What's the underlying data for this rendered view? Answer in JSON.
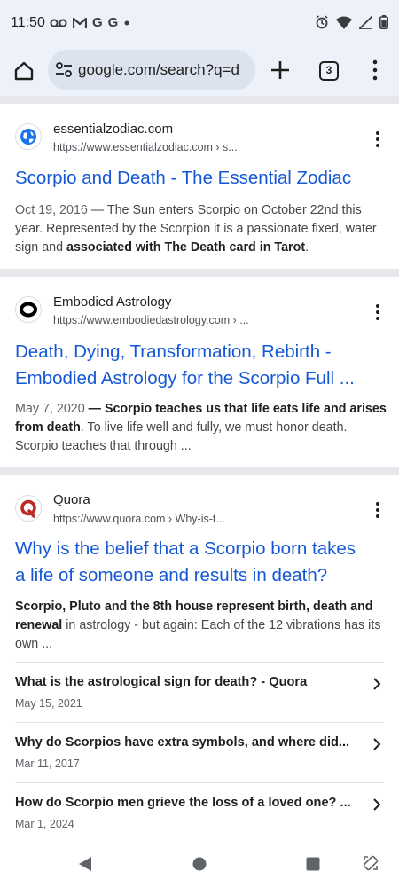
{
  "status_bar": {
    "time": "11:50",
    "left_icons": [
      "voicemail-icon",
      "gmail-icon",
      "google-icon",
      "google-icon",
      "dot-icon"
    ],
    "right_icons": [
      "alarm-icon",
      "wifi-icon",
      "signal-icon",
      "battery-icon"
    ]
  },
  "toolbar": {
    "url": "google.com/search?q=d",
    "tab_count": "3"
  },
  "results": [
    {
      "site_name": "essentialzodiac.com",
      "site_url": "https://www.essentialzodiac.com › s...",
      "title": "Scorpio and Death - The Essential Zodiac",
      "snippet_date": "Oct 19, 2016",
      "snippet_part1": " — The Sun enters Scorpio on October 22nd this year. Represented by the Scorpion it is a passionate fixed, water sign and ",
      "snippet_bold": "associated with The Death card in Tarot",
      "snippet_part2": "."
    },
    {
      "site_name": "Embodied Astrology",
      "site_url": "https://www.embodiedastrology.com › ...",
      "title_line1": "Death, Dying, Transformation, Rebirth -",
      "title_line2": "Embodied Astrology for the Scorpio Full ...",
      "snippet_date": "May 7, 2020",
      "snippet_dash": " — ",
      "snippet_bold": "Scorpio teaches us that life eats life and arises from death",
      "snippet_part2": ". To live life well and fully, we must honor death. Scorpio teaches that through ..."
    },
    {
      "site_name": "Quora",
      "site_url": "https://www.quora.com › Why-is-t...",
      "title_line1": "Why is the belief that a Scorpio born takes",
      "title_line2": "a life of someone and results in death?",
      "snippet_bold": "Scorpio, Pluto and the 8th house represent birth, death and renewal",
      "snippet_part2": " in astrology - but again: Each of the 12 vibrations has its own ...",
      "sub_questions": [
        {
          "question": "What is the astrological sign for death? - Quora",
          "date": "May 15, 2021"
        },
        {
          "question": "Why do Scorpios have extra symbols, and where did...",
          "date": "Mar 11, 2017"
        },
        {
          "question": "How do Scorpio men grieve the loss of a loved one? ...",
          "date": "Mar 1, 2024"
        }
      ]
    }
  ],
  "colors": {
    "link_blue": "#1558d6",
    "toolbar_bg": "#edf2fa",
    "omnibox_bg": "#dde3ee",
    "quora_red": "#b92b27",
    "globe_blue": "#1a73e8"
  }
}
